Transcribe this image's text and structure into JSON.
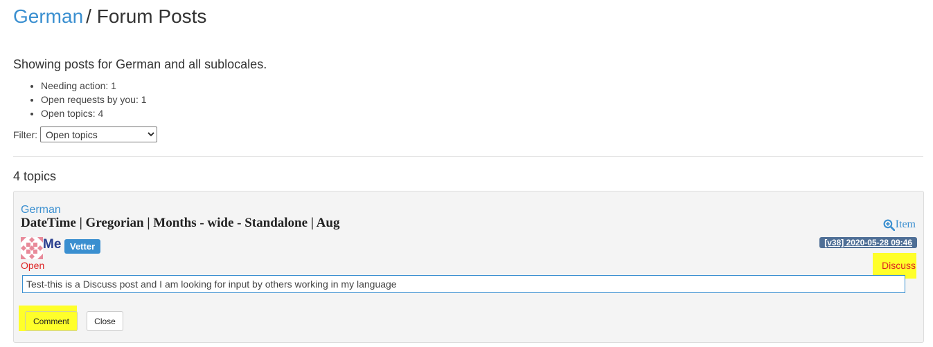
{
  "header": {
    "locale_link": "German",
    "separator": "/",
    "page_title": "Forum Posts"
  },
  "summary": {
    "text": "Showing posts for German and all sublocales.",
    "stats": [
      "Needing action: 1",
      "Open requests by you: 1",
      "Open topics: 4"
    ]
  },
  "filter": {
    "label": "Filter:",
    "selected": "Open topics"
  },
  "topics": {
    "count_label": "4 topics"
  },
  "post": {
    "locale": "German",
    "path": "DateTime | Gregorian | Months - wide - Standalone | Aug",
    "item_link": "Item",
    "user": "Me",
    "role_badge": "Vetter",
    "version_date": "[v38] 2020-05-28 09:46",
    "status": "Open",
    "type": "Discuss",
    "text": "Test-this is a Discuss post and I am looking for input by others working in my language",
    "comment_button": "Comment",
    "close_button": "Close"
  },
  "colors": {
    "link_blue": "#3a8fd0",
    "status_red": "#dd2222",
    "highlight_yellow": "#ffff2a",
    "date_badge": "#4f6f96"
  },
  "icons": {
    "item": "zoom-in-icon",
    "avatar": "identicon-avatar"
  }
}
